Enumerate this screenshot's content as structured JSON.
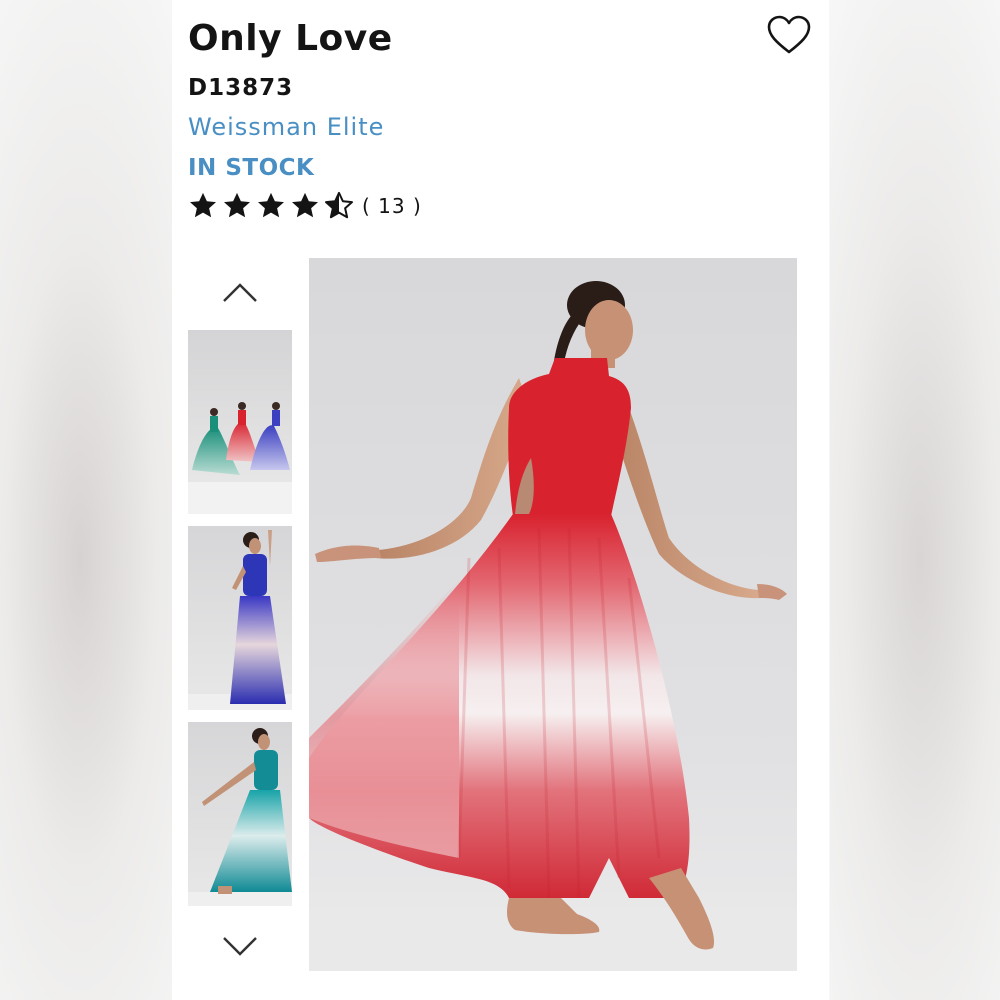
{
  "product": {
    "name": "Only Love",
    "sku": "D13873",
    "brand": "Weissman Elite",
    "stock_status": "IN STOCK",
    "rating": 4.5,
    "review_count": "( 13 )"
  },
  "colors": {
    "text": "#141414",
    "accent": "#4a8fc4",
    "dress_red": "#d8232f",
    "dress_blue": "#2e36b8",
    "dress_teal": "#138c95"
  },
  "icons": {
    "favorite": "heart-outline-icon",
    "thumb_prev": "chevron-up-icon",
    "thumb_next": "chevron-down-icon",
    "rating": "star-icon"
  },
  "gallery": {
    "thumbnails": [
      "group",
      "blue",
      "teal"
    ],
    "selected": "red"
  }
}
